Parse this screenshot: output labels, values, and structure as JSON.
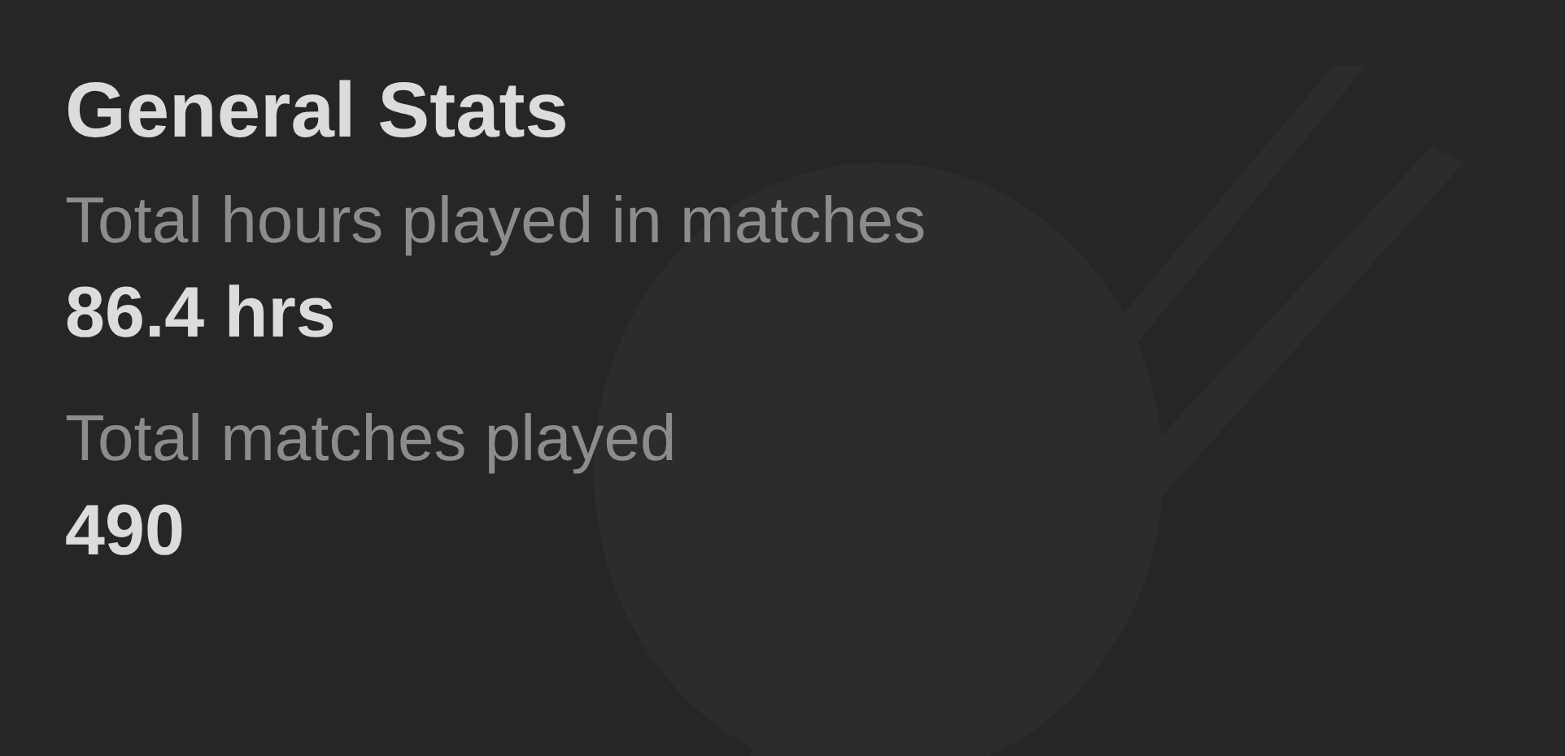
{
  "title": "General Stats",
  "stats": [
    {
      "label": "Total hours played in matches",
      "value": "86.4 hrs"
    },
    {
      "label": "Total matches played",
      "value": "490"
    }
  ]
}
